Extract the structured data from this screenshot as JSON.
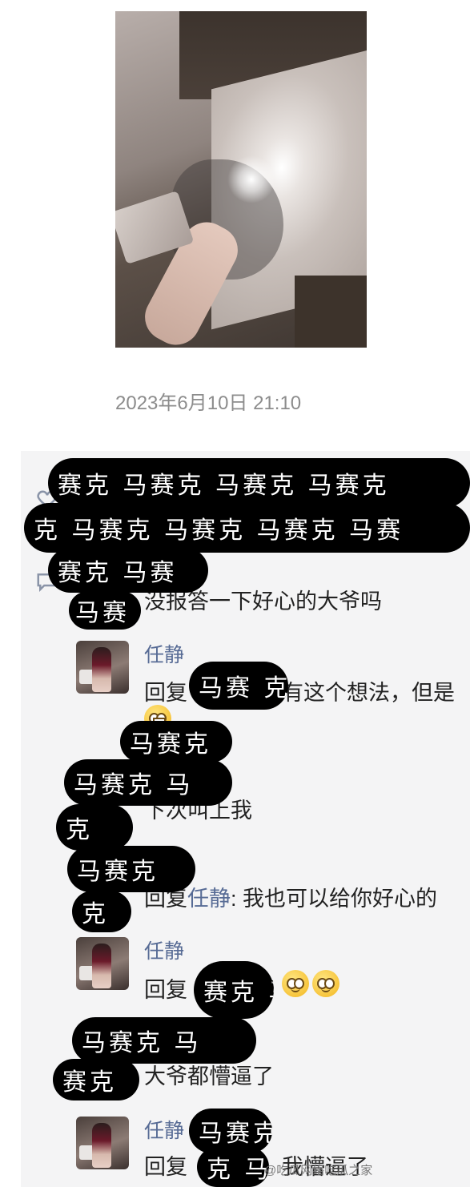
{
  "post": {
    "timestamp": "2023年6月10日 21:10"
  },
  "comments": [
    {
      "type": "comment",
      "text": "没报答一下好心的大爷吗"
    },
    {
      "type": "reply",
      "author": "任静",
      "prefix": "回复",
      "text": "有这个想法，但是"
    },
    {
      "type": "comment",
      "text": "下次叫上我"
    },
    {
      "type": "comment",
      "prefix": "回复",
      "reply_to": "任静",
      "text": ": 我也可以给你好心的"
    },
    {
      "type": "reply",
      "author": "任静",
      "prefix": "回复",
      "text": ":"
    },
    {
      "type": "comment",
      "text": "大爷都懵逼了"
    },
    {
      "type": "reply",
      "author": "任静",
      "prefix": "回复",
      "text": "我懵逼了"
    }
  ],
  "redaction_text": {
    "a": "赛克 马赛克 马赛克 马赛克",
    "b": "克 马赛克 马赛克 马赛克 马赛",
    "c": "赛克 马赛",
    "d": "马赛",
    "e": "马赛 克",
    "f": "马赛克",
    "g": "赛克",
    "h": "马赛克 马",
    "i": "克",
    "j": "马赛克 马",
    "k": "赛克 马",
    "l": "马 赛克",
    "m": "马赛克 马",
    "n": "马赛克",
    "o": "克 马"
  },
  "watermark": "@吃瓜网络吃瓜之家",
  "icons": {
    "like": "heart-outline-icon",
    "comment": "comment-bubble-icon",
    "emoji_grin": "grinning-emoji-icon",
    "emoji_pleading": "pleading-emoji-icon"
  }
}
